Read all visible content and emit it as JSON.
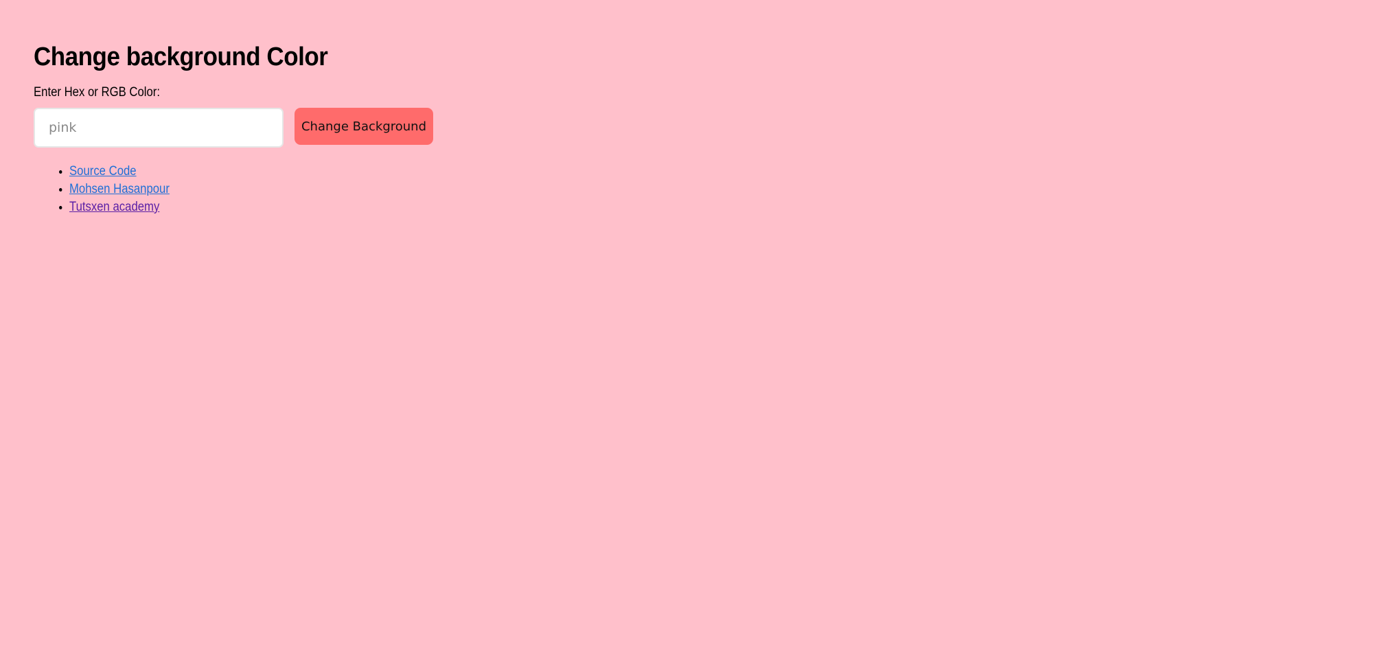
{
  "page": {
    "title": "Change background Color",
    "background_color": "#FFC0CB"
  },
  "form": {
    "label": "Enter Hex or RGB Color:",
    "input_value": "",
    "input_placeholder": "pink",
    "button_label": "Change Background",
    "button_color": "#FF6B6B"
  },
  "links": [
    {
      "label": "Source Code",
      "color": "#1f6fd6"
    },
    {
      "label": "Mohsen Hasanpour",
      "color": "#1f6fd6"
    },
    {
      "label": "Tutsxen academy",
      "color": "#5a1fa6"
    }
  ]
}
